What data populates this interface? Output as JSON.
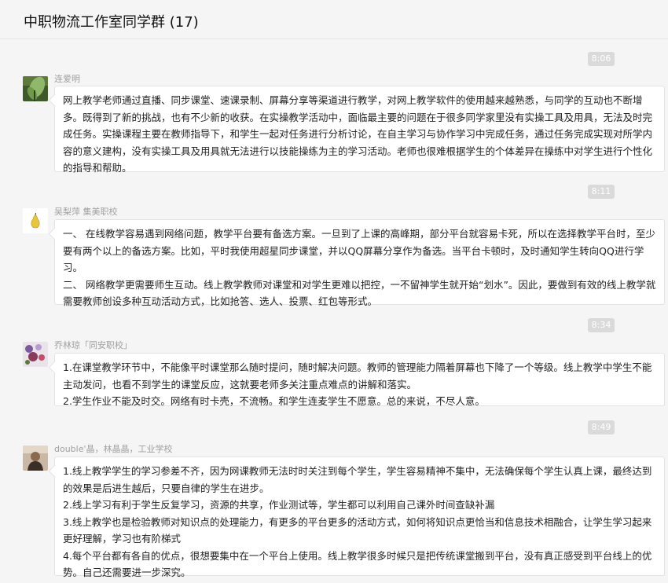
{
  "header": {
    "title": "中职物流工作室同学群 (17)"
  },
  "messages": [
    {
      "time": "8:06",
      "sender": "连爱明",
      "avatar_icon": "plant-photo-icon",
      "paragraphs": [
        "网上教学老师通过直播、同步课堂、速课录制、屏幕分享等渠道进行教学，对网上教学软件的使用越来越熟悉，与同学的互动也不断增多。既得到了新的挑战，也有不少新的收获。在实操教学活动中，面临最主要的问题在于很多同学家里没有实操工具及用具，无法及时完成任务。实操课程主要在教师指导下，和学生一起对任务进行分析讨论，在自主学习与协作学习中完成任务，通过任务完成实现对所学内容的意义建构，没有实操工具及用具就无法进行以技能操练为主的学习活动。老师也很难根据学生的个体差异在操练中对学生进行个性化的指导和帮助。"
      ]
    },
    {
      "time": "8:11",
      "sender": "吴梨萍  集美职校",
      "avatar_icon": "pear-icon",
      "paragraphs": [
        "一、 在线教学容易遇到网络问题，教学平台要有备选方案。一旦到了上课的高峰期，部分平台就容易卡死，所以在选择教学平台时，至少要有两个以上的备选方案。比如，平时我使用超星同步课堂，并以QQ屏幕分享作为备选。当平台卡顿时，及时通知学生转向QQ进行学习。",
        "二、 网络教学更需要师生互动。线上教学教师对课堂和对学生更难以把控，一不留神学生就开始“划水”。因此，要做到有效的线上教学就需要教师创设多种互动活动方式，比如抢答、选人、投票、红包等形式。"
      ]
    },
    {
      "time": "8:34",
      "sender": "乔林琼「同安职校」",
      "avatar_icon": "flowers-photo-icon",
      "paragraphs": [
        "1.在课堂教学环节中，不能像平时课堂那么随时提问，随时解决问题。教师的管理能力隔着屏幕也下降了一个等级。线上教学中学生不能主动发问，也看不到学生的课堂反应，这就要老师多关注重点难点的讲解和落实。",
        "2.学生作业不能及时交。网络有时卡壳，不流畅。和学生连麦学生不愿意。总的来说，不尽人意。"
      ]
    },
    {
      "time": "8:49",
      "sender": "double'晶，林晶晶，工业学校",
      "avatar_icon": "portrait-photo-icon",
      "paragraphs": [
        "1.线上教学学生的学习参差不齐，因为网课教师无法时时关注到每个学生，学生容易精神不集中，无法确保每个学生认真上课，最终达到的效果是后进生越后，只要自律的学生在进步。",
        "2.线上学习有利于学生反复学习，资源的共享，作业测试等，学生都可以利用自己课外时间查缺补漏",
        "3.线上教学也是检验教师对知识点的处理能力，有更多的平台更多的活动方式，如何将知识点更恰当和信息技术相融合，让学生学习起来更好理解，学习也有阶梯式",
        "4.每个平台都有各自的优点，很想要集中在一个平台上使用。线上教学很多时候只是把传统课堂搬到平台，没有真正感受到平台线上的优势。自己还需要进一步深究。"
      ]
    }
  ]
}
